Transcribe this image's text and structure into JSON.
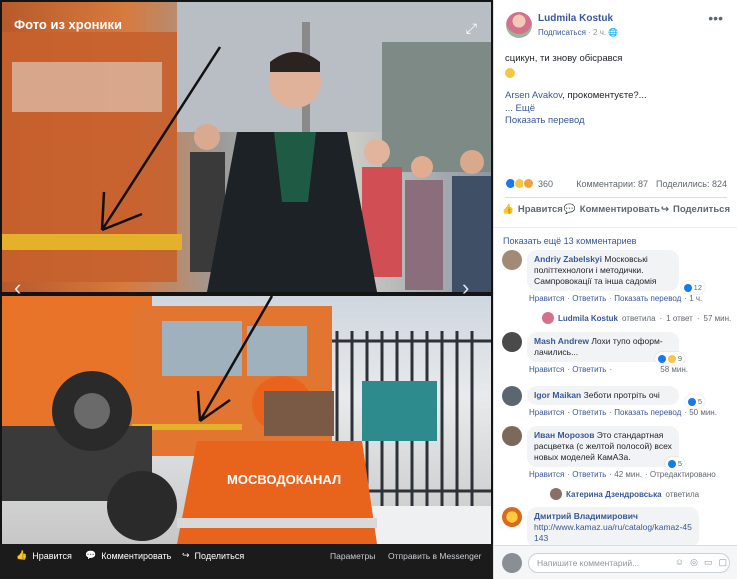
{
  "viewer": {
    "title": "Фото из хроники",
    "footer": {
      "like": "Нравится",
      "comment": "Комментировать",
      "share": "Поделиться",
      "params": "Параметры",
      "messenger": "Отправить в Messenger"
    },
    "truck_text": "МОСВОДОКАНАЛ"
  },
  "post": {
    "author": "Ludmila Kostuk",
    "audience": "Подписаться",
    "time": "2 ч.",
    "text_line1": "сцикун, ти знову обісрався",
    "mention": "Arsen Avakov",
    "text_line2": ", прокоментуєте?...",
    "more": "... Ещё",
    "translate": "Показать перевод",
    "reactions_count": "360",
    "comments_count": "Комментарии: 87",
    "shares_count": "Поделились: 824",
    "actions": {
      "like": "Нравится",
      "comment": "Комментировать",
      "share": "Поделиться"
    }
  },
  "comments": {
    "show_more": "Показать ещё 13 комментариев",
    "items": [
      {
        "name": "Andriy Zabelskyi",
        "text": "Московські політтехнологи і методички. Сампровокації та інша садомія",
        "likes": "12",
        "like": "Нравится",
        "reply": "Ответить",
        "translate": "Показать перевод",
        "time": "1 ч."
      },
      {
        "name": "Mash Andrew",
        "text": "Лохи тупо оформ­лачились...",
        "likes": "9",
        "like": "Нравится",
        "reply": "Ответить",
        "time": "58 мин."
      },
      {
        "name": "Igor Maikan",
        "text": "Зеботи протріть очі",
        "likes": "5",
        "like": "Нравится",
        "reply": "Ответить",
        "translate": "Показать перевод",
        "time": "50 мин."
      },
      {
        "name": "Иван Морозов",
        "text": "Это стандартная расцветка (с желтой полосой) всех новых моделей КамАЗа.",
        "likes": "5",
        "like": "Нравится",
        "reply": "Ответить",
        "time": "42 мин.",
        "edited": "Отредактировано"
      },
      {
        "name": "Дмитрий Владимирович",
        "text": "http://www.kamaz.ua/ru/catalog/kamaz-45143"
      }
    ],
    "replies": [
      {
        "name": "Ludmila Kostuk",
        "action": "ответила",
        "count": "1 ответ",
        "time": "57 мин."
      },
      {
        "name": "Катерина Дзендровська",
        "action": "ответила"
      }
    ],
    "composer_placeholder": "Напишите комментарий..."
  },
  "colors": {
    "link": "#385898",
    "like_blue": "#1877f2",
    "haha_yellow": "#f7c644",
    "orange_vest": "#e8641c"
  }
}
